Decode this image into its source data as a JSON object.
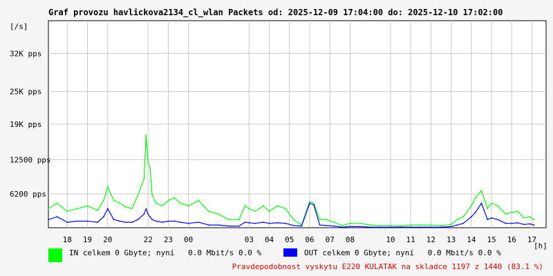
{
  "chart_data": {
    "type": "area",
    "title": "Graf provozu havlickova2134_cl_wlan Packets od: 2025-12-09 17:04:00 do: 2025-12-10 17:02:00",
    "y_unit_label": "[/s]",
    "x_unit_label": "[h]",
    "y_ticks": [
      {
        "value": 6200,
        "label": "6200 pps"
      },
      {
        "value": 12500,
        "label": "12500 pps"
      },
      {
        "value": 19000,
        "label": "19K pps"
      },
      {
        "value": 25000,
        "label": "25K pps"
      },
      {
        "value": 32000,
        "label": "32K pps"
      }
    ],
    "ylim": [
      0,
      38000
    ],
    "xlim": [
      17.066,
      41.7
    ],
    "x_tick_labels": [
      {
        "hour": 18,
        "label": "18"
      },
      {
        "hour": 19,
        "label": "19"
      },
      {
        "hour": 20,
        "label": "20"
      },
      {
        "hour": 22,
        "label": "22"
      },
      {
        "hour": 23,
        "label": "23"
      },
      {
        "hour": 24,
        "label": "00"
      },
      {
        "hour": 27,
        "label": "03"
      },
      {
        "hour": 28,
        "label": "04"
      },
      {
        "hour": 29,
        "label": "05"
      },
      {
        "hour": 30,
        "label": "06"
      },
      {
        "hour": 31,
        "label": "07"
      },
      {
        "hour": 32,
        "label": "08"
      },
      {
        "hour": 34,
        "label": "10"
      },
      {
        "hour": 35,
        "label": "11"
      },
      {
        "hour": 36,
        "label": "12"
      },
      {
        "hour": 37,
        "label": "13"
      },
      {
        "hour": 38,
        "label": "14"
      },
      {
        "hour": 39,
        "label": "15"
      },
      {
        "hour": 40,
        "label": "16"
      },
      {
        "hour": 41,
        "label": "17"
      }
    ],
    "series": [
      {
        "name": "IN",
        "color": "#00ff00",
        "x": [
          17.07,
          17.5,
          18.0,
          18.5,
          19.0,
          19.5,
          19.8,
          20.0,
          20.3,
          20.6,
          20.9,
          21.2,
          21.5,
          21.8,
          21.9,
          22.0,
          22.1,
          22.2,
          22.4,
          22.7,
          23.0,
          23.3,
          23.6,
          24.0,
          24.5,
          25.0,
          25.5,
          26.0,
          26.5,
          26.8,
          27.0,
          27.3,
          27.7,
          28.0,
          28.4,
          28.8,
          29.2,
          29.6,
          30.0,
          30.2,
          30.5,
          30.8,
          31.2,
          31.6,
          32.0,
          32.5,
          33.0,
          33.5,
          34.0,
          34.5,
          35.0,
          35.5,
          36.0,
          36.5,
          37.0,
          37.3,
          37.6,
          38.0,
          38.2,
          38.5,
          38.8,
          39.0,
          39.3,
          39.7,
          40.0,
          40.3,
          40.6,
          40.9,
          41.1
        ],
        "y": [
          3500,
          4500,
          3000,
          3500,
          4000,
          3200,
          5000,
          7500,
          5000,
          4500,
          3800,
          3500,
          6000,
          9000,
          17000,
          12000,
          11000,
          6000,
          4500,
          4000,
          5000,
          5500,
          4500,
          4000,
          5000,
          3000,
          2500,
          1500,
          1500,
          4000,
          3500,
          3000,
          4000,
          3000,
          4000,
          3500,
          1500,
          500,
          4800,
          4500,
          1500,
          1500,
          1000,
          400,
          800,
          800,
          500,
          400,
          400,
          300,
          500,
          500,
          500,
          400,
          600,
          1500,
          2000,
          4000,
          5500,
          6800,
          3500,
          4500,
          4000,
          2500,
          2800,
          3000,
          1800,
          2000,
          1500
        ]
      },
      {
        "name": "OUT",
        "color": "#0000ff",
        "x": [
          17.07,
          17.5,
          18.0,
          18.5,
          19.0,
          19.5,
          19.8,
          20.0,
          20.3,
          20.6,
          20.9,
          21.2,
          21.5,
          21.8,
          21.9,
          22.0,
          22.1,
          22.2,
          22.4,
          22.7,
          23.0,
          23.3,
          23.6,
          24.0,
          24.5,
          25.0,
          25.5,
          26.0,
          26.5,
          26.8,
          27.0,
          27.3,
          27.7,
          28.0,
          28.4,
          28.8,
          29.2,
          29.6,
          30.0,
          30.2,
          30.5,
          30.8,
          31.2,
          31.6,
          32.0,
          32.5,
          33.0,
          33.5,
          34.0,
          34.5,
          35.0,
          35.5,
          36.0,
          36.5,
          37.0,
          37.3,
          37.6,
          38.0,
          38.2,
          38.5,
          38.8,
          39.0,
          39.3,
          39.7,
          40.0,
          40.3,
          40.6,
          40.9,
          41.1
        ],
        "y": [
          1500,
          2000,
          1000,
          1200,
          1200,
          1000,
          2000,
          3500,
          1500,
          1200,
          1000,
          1000,
          1500,
          2500,
          3500,
          2500,
          2000,
          1500,
          1200,
          1000,
          1200,
          1200,
          1000,
          800,
          1000,
          500,
          500,
          300,
          300,
          1000,
          900,
          800,
          1000,
          800,
          900,
          800,
          400,
          300,
          4500,
          4200,
          500,
          400,
          300,
          100,
          200,
          200,
          100,
          100,
          100,
          100,
          100,
          100,
          100,
          100,
          200,
          500,
          800,
          2000,
          2800,
          4500,
          1500,
          1800,
          1500,
          800,
          800,
          900,
          600,
          700,
          500
        ]
      }
    ]
  },
  "legend": {
    "in_text": "IN celkem 0 Gbyte; nyní   0.0 Mbit/s 0.0 %",
    "out_text": "OUT celkem 0 Gbyte; nyní   0.0 Mbit/s 0.0 %",
    "in_color": "#00ff00",
    "out_color": "#0000ff"
  },
  "footer_text": "Pravdepodobnost vyskytu E220 KULATAK na skladce 1197 z 1440 (83.1 %)"
}
